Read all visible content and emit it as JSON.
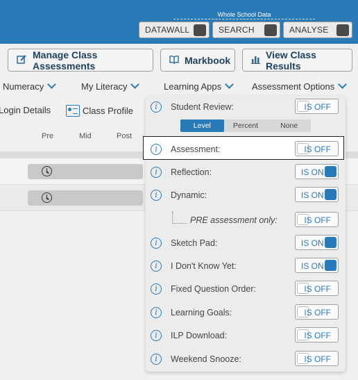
{
  "header": {
    "group_label": "Whole School Data",
    "buttons": [
      {
        "label": "DATAWALL"
      },
      {
        "label": "SEARCH"
      },
      {
        "label": "ANALYSE"
      }
    ]
  },
  "actions": {
    "manage_label": "Manage Class Assessments",
    "markbook_label": "Markbook",
    "results_label": "View Class Results"
  },
  "nav": {
    "numeracy": "Numeracy",
    "literacy": "My Literacy",
    "learning_apps": "Learning Apps",
    "assessment_options": "Assessment Options"
  },
  "subnav": {
    "login_details": "Login Details",
    "class_profile": "Class Profile"
  },
  "columns": {
    "pre": "Pre",
    "mid": "Mid",
    "post": "Post"
  },
  "panel": {
    "student_review": {
      "label": "Student Review:",
      "state": "IS OFF"
    },
    "segment": {
      "options": [
        "Level",
        "Percent",
        "None"
      ],
      "selected": "Level"
    },
    "assessment": {
      "label": "Assessment:",
      "state": "IS OFF"
    },
    "reflection": {
      "label": "Reflection:",
      "state": "IS ON"
    },
    "dynamic": {
      "label": "Dynamic:",
      "state": "IS ON"
    },
    "pre_only": {
      "label": "PRE assessment only:",
      "state": "IS OFF"
    },
    "sketch_pad": {
      "label": "Sketch Pad:",
      "state": "IS ON"
    },
    "dont_know": {
      "label": "I Don't Know Yet:",
      "state": "IS ON"
    },
    "fixed_order": {
      "label": "Fixed Question Order:",
      "state": "IS OFF"
    },
    "learning_goals": {
      "label": "Learning Goals:",
      "state": "IS OFF"
    },
    "ilp_download": {
      "label": "ILP Download:",
      "state": "IS OFF"
    },
    "weekend_snooze": {
      "label": "Weekend Snooze:",
      "state": "IS OFF"
    }
  },
  "colors": {
    "brand_blue": "#2a7ab8",
    "panel_bg": "#ececec"
  }
}
